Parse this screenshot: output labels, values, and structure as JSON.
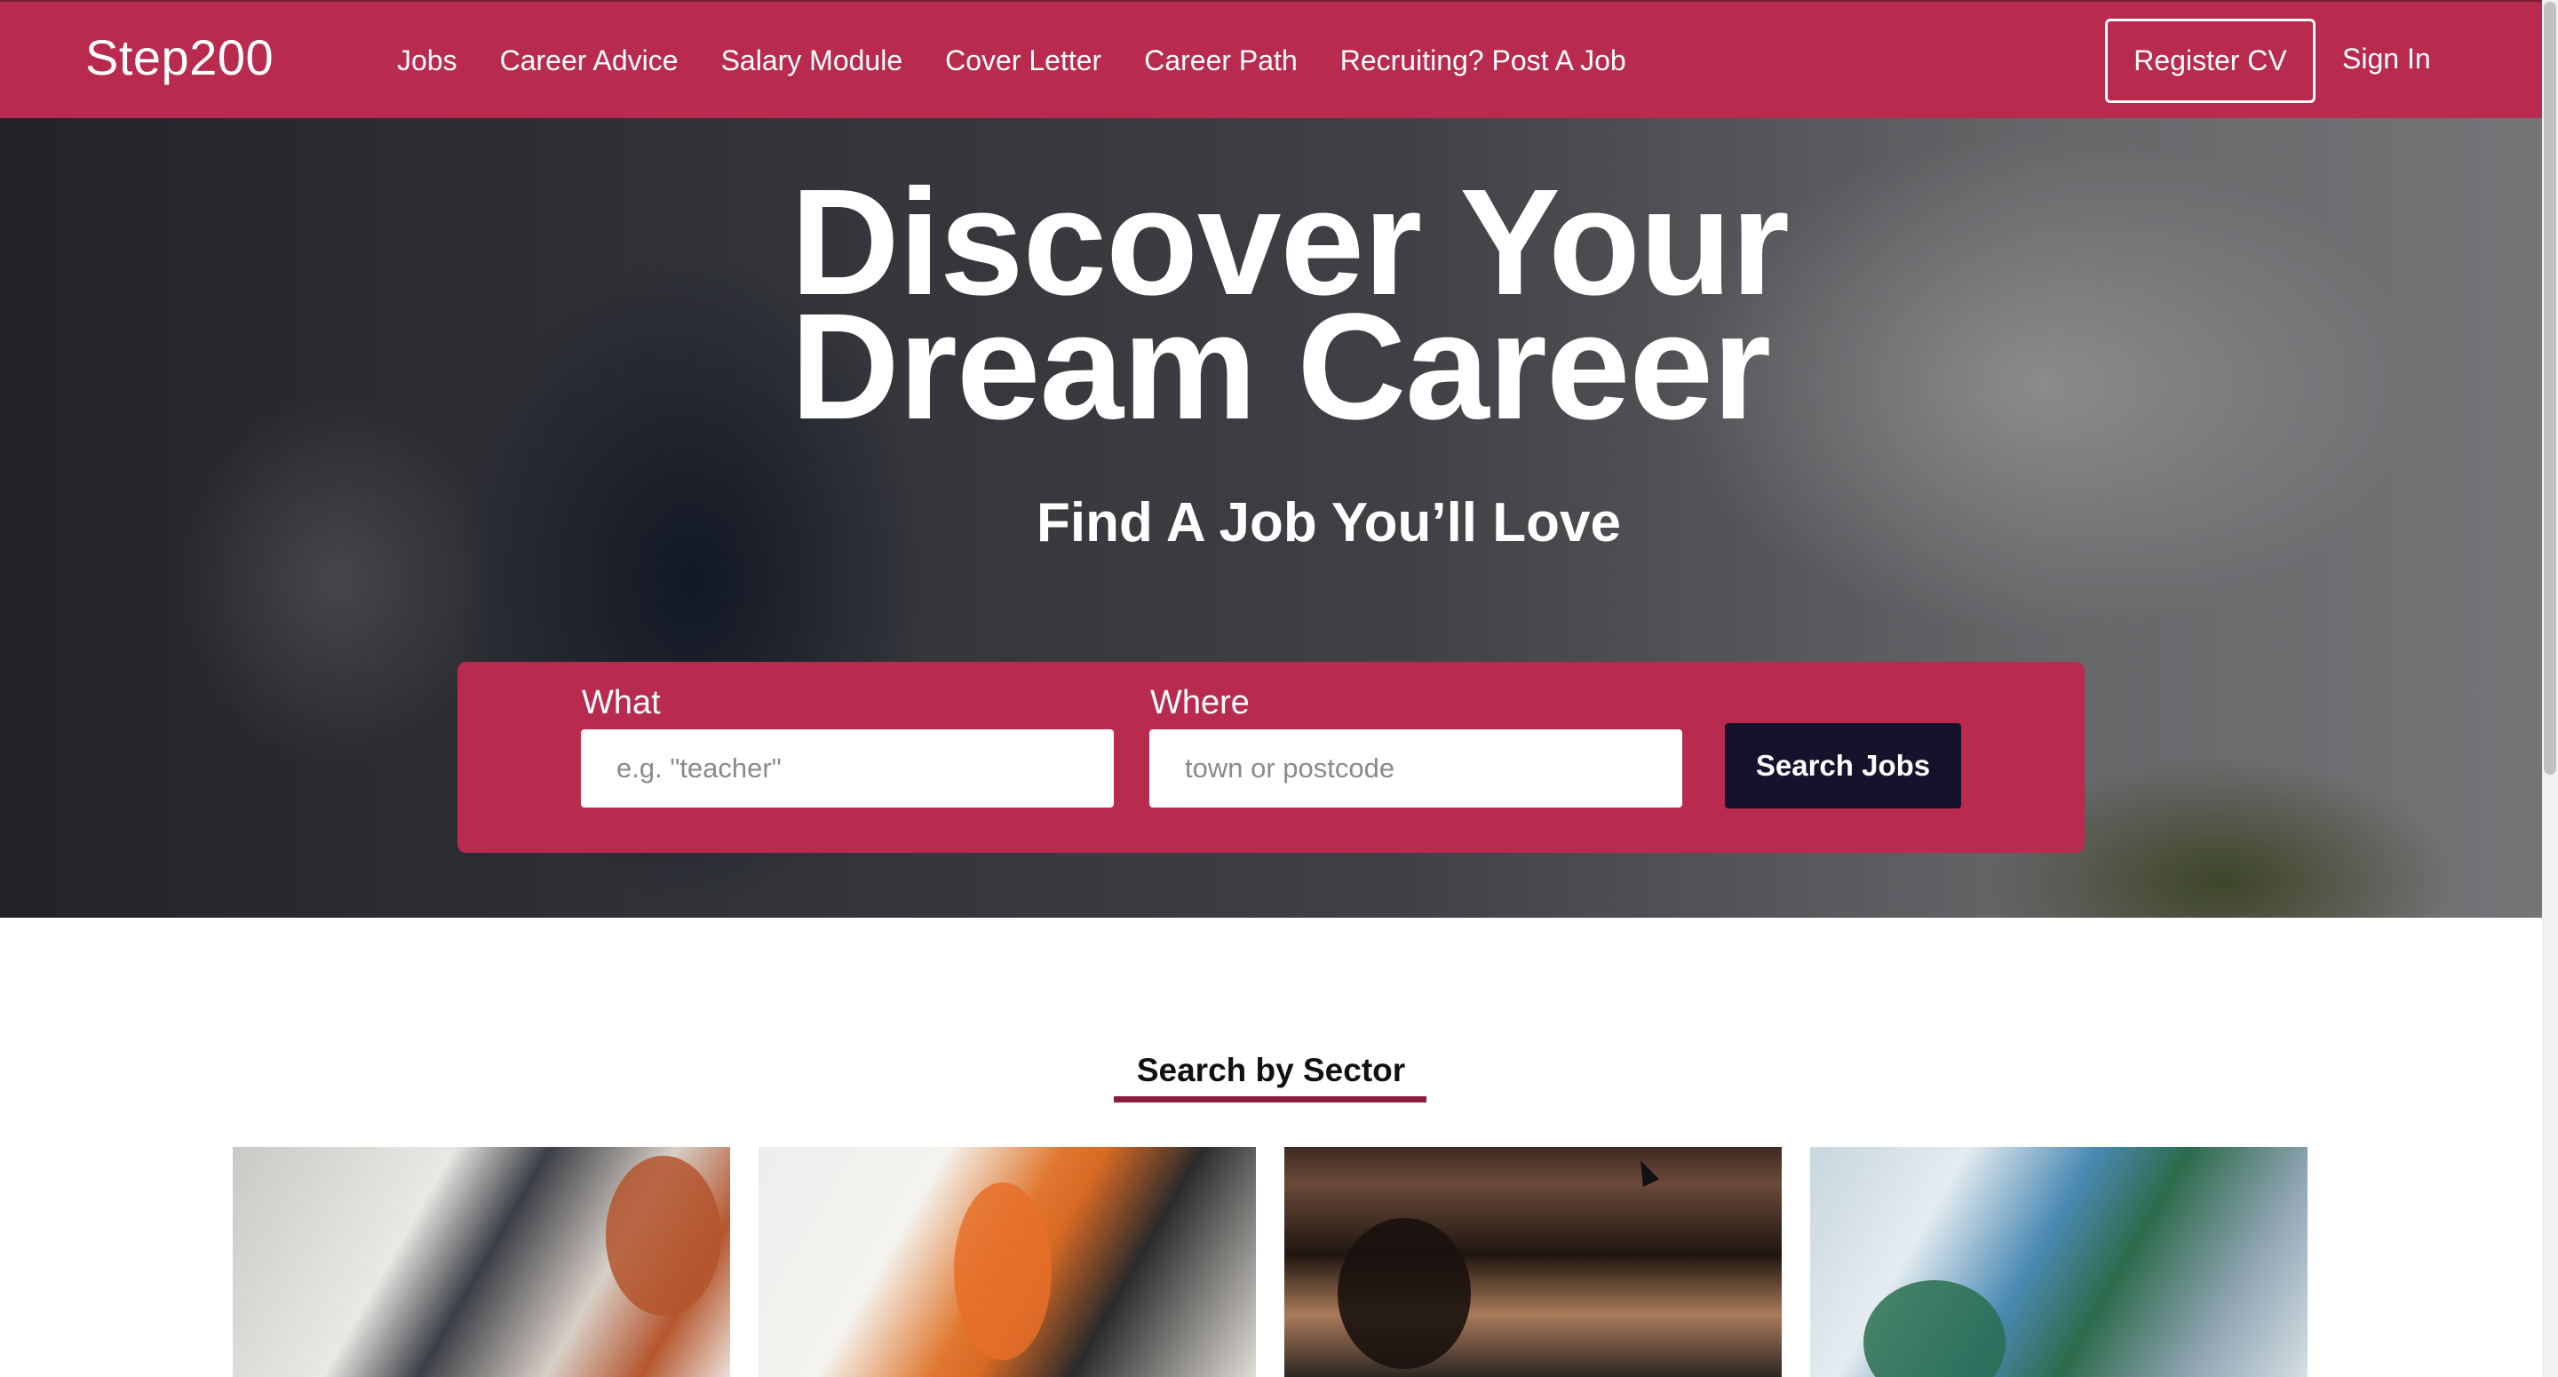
{
  "navbar": {
    "brand": "Step200",
    "links": [
      {
        "label": "Jobs"
      },
      {
        "label": "Career Advice"
      },
      {
        "label": "Salary Module"
      },
      {
        "label": "Cover Letter"
      },
      {
        "label": "Career Path"
      },
      {
        "label": "Recruiting? Post A Job"
      }
    ],
    "register_label": "Register CV",
    "signin_label": "Sign In"
  },
  "hero": {
    "title_line1": "Discover Your",
    "title_line2": "Dream Career",
    "subtitle": "Find A Job You’ll Love"
  },
  "search": {
    "what_label": "What",
    "what_placeholder": "e.g. \"teacher\"",
    "where_label": "Where",
    "where_placeholder": "town or postcode",
    "button_label": "Search Jobs"
  },
  "sectors": {
    "heading": "Search by Sector",
    "cards": [
      {
        "image": "office-developer-photo"
      },
      {
        "image": "construction-planning-photo"
      },
      {
        "image": "students-smiling-photo"
      },
      {
        "image": "surgeons-operating-room-photo"
      }
    ]
  },
  "colors": {
    "brand": "#b82a4e",
    "button_dark": "#15122c",
    "underline": "#8a1d3a"
  }
}
